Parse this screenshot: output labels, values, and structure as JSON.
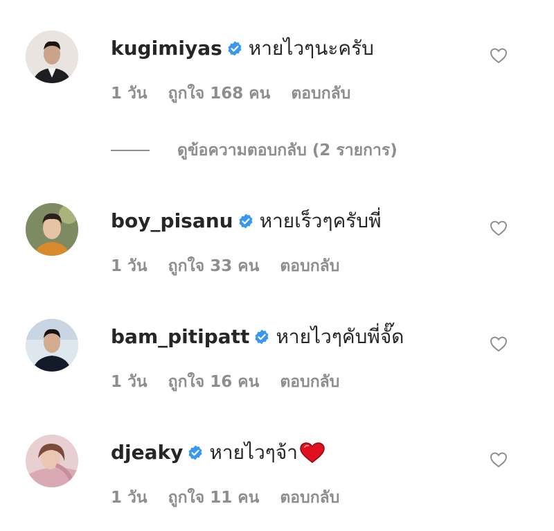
{
  "comments": [
    {
      "username": "kugimiyas",
      "text": "หายไวๆนะครับ",
      "time": "1 วัน",
      "likes": "ถูกใจ 168 คน",
      "reply": "ตอบกลับ",
      "verified": true,
      "view_replies": "ดูข้อความตอบกลับ (2 รายการ)"
    },
    {
      "username": "boy_pisanu",
      "text": "หายเร็วๆครับพี่",
      "time": "1 วัน",
      "likes": "ถูกใจ 33 คน",
      "reply": "ตอบกลับ",
      "verified": true
    },
    {
      "username": "bam_pitipatt",
      "text": "หายไวๆคับพี่จั๊ด",
      "time": "1 วัน",
      "likes": "ถูกใจ 16 คน",
      "reply": "ตอบกลับ",
      "verified": true
    },
    {
      "username": "djeaky",
      "text": "หายไวๆจ้า",
      "emoji": "red-heart-emoji",
      "time": "1 วัน",
      "likes": "ถูกใจ 11 คน",
      "reply": "ตอบกลับ",
      "verified": true
    }
  ],
  "colors": {
    "text": "#262626",
    "meta": "#8e8e8e",
    "verified": "#3897f0",
    "heart": "#e0101f"
  },
  "icons": {
    "verified": "verified-badge-icon",
    "like": "heart-outline-icon",
    "emoji": "red-heart-emoji"
  }
}
